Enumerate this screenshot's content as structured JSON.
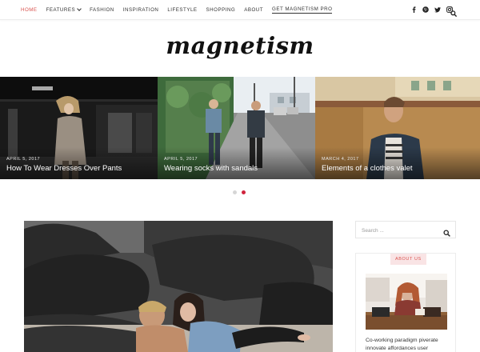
{
  "nav": {
    "items": [
      {
        "label": "HOME",
        "active": true,
        "dropdown": false
      },
      {
        "label": "FEATURES",
        "active": false,
        "dropdown": true
      },
      {
        "label": "FASHION",
        "active": false,
        "dropdown": false
      },
      {
        "label": "INSPIRATION",
        "active": false,
        "dropdown": false
      },
      {
        "label": "LIFESTYLE",
        "active": false,
        "dropdown": false
      },
      {
        "label": "SHOPPING",
        "active": false,
        "dropdown": false
      },
      {
        "label": "ABOUT",
        "active": false,
        "dropdown": false
      },
      {
        "label": "GET MAGNETISM PRO",
        "active": false,
        "dropdown": false
      }
    ],
    "social_icons": [
      "facebook-icon",
      "pinterest-icon",
      "twitter-icon",
      "instagram-icon"
    ],
    "search_icon": "search-icon"
  },
  "logo": {
    "text": "magnetism"
  },
  "slider": {
    "slides": [
      {
        "date": "APRIL 5, 2017",
        "title": "How To Wear Dresses Over Pants"
      },
      {
        "date": "APRIL 5, 2017",
        "title": "Wearing socks with sandals"
      },
      {
        "date": "MARCH 4, 2017",
        "title": "Elements of a clothes valet"
      }
    ],
    "active_dot": 1,
    "dot_count": 2
  },
  "sidebar": {
    "search": {
      "placeholder": "Search ..."
    },
    "about": {
      "badge": "ABOUT US",
      "text": "Co-working paradigm piverate innovate affordances user"
    }
  },
  "colors": {
    "accent": "#d9534f",
    "dot_active": "#d0243d",
    "badge_bg": "#f9e4e5"
  }
}
